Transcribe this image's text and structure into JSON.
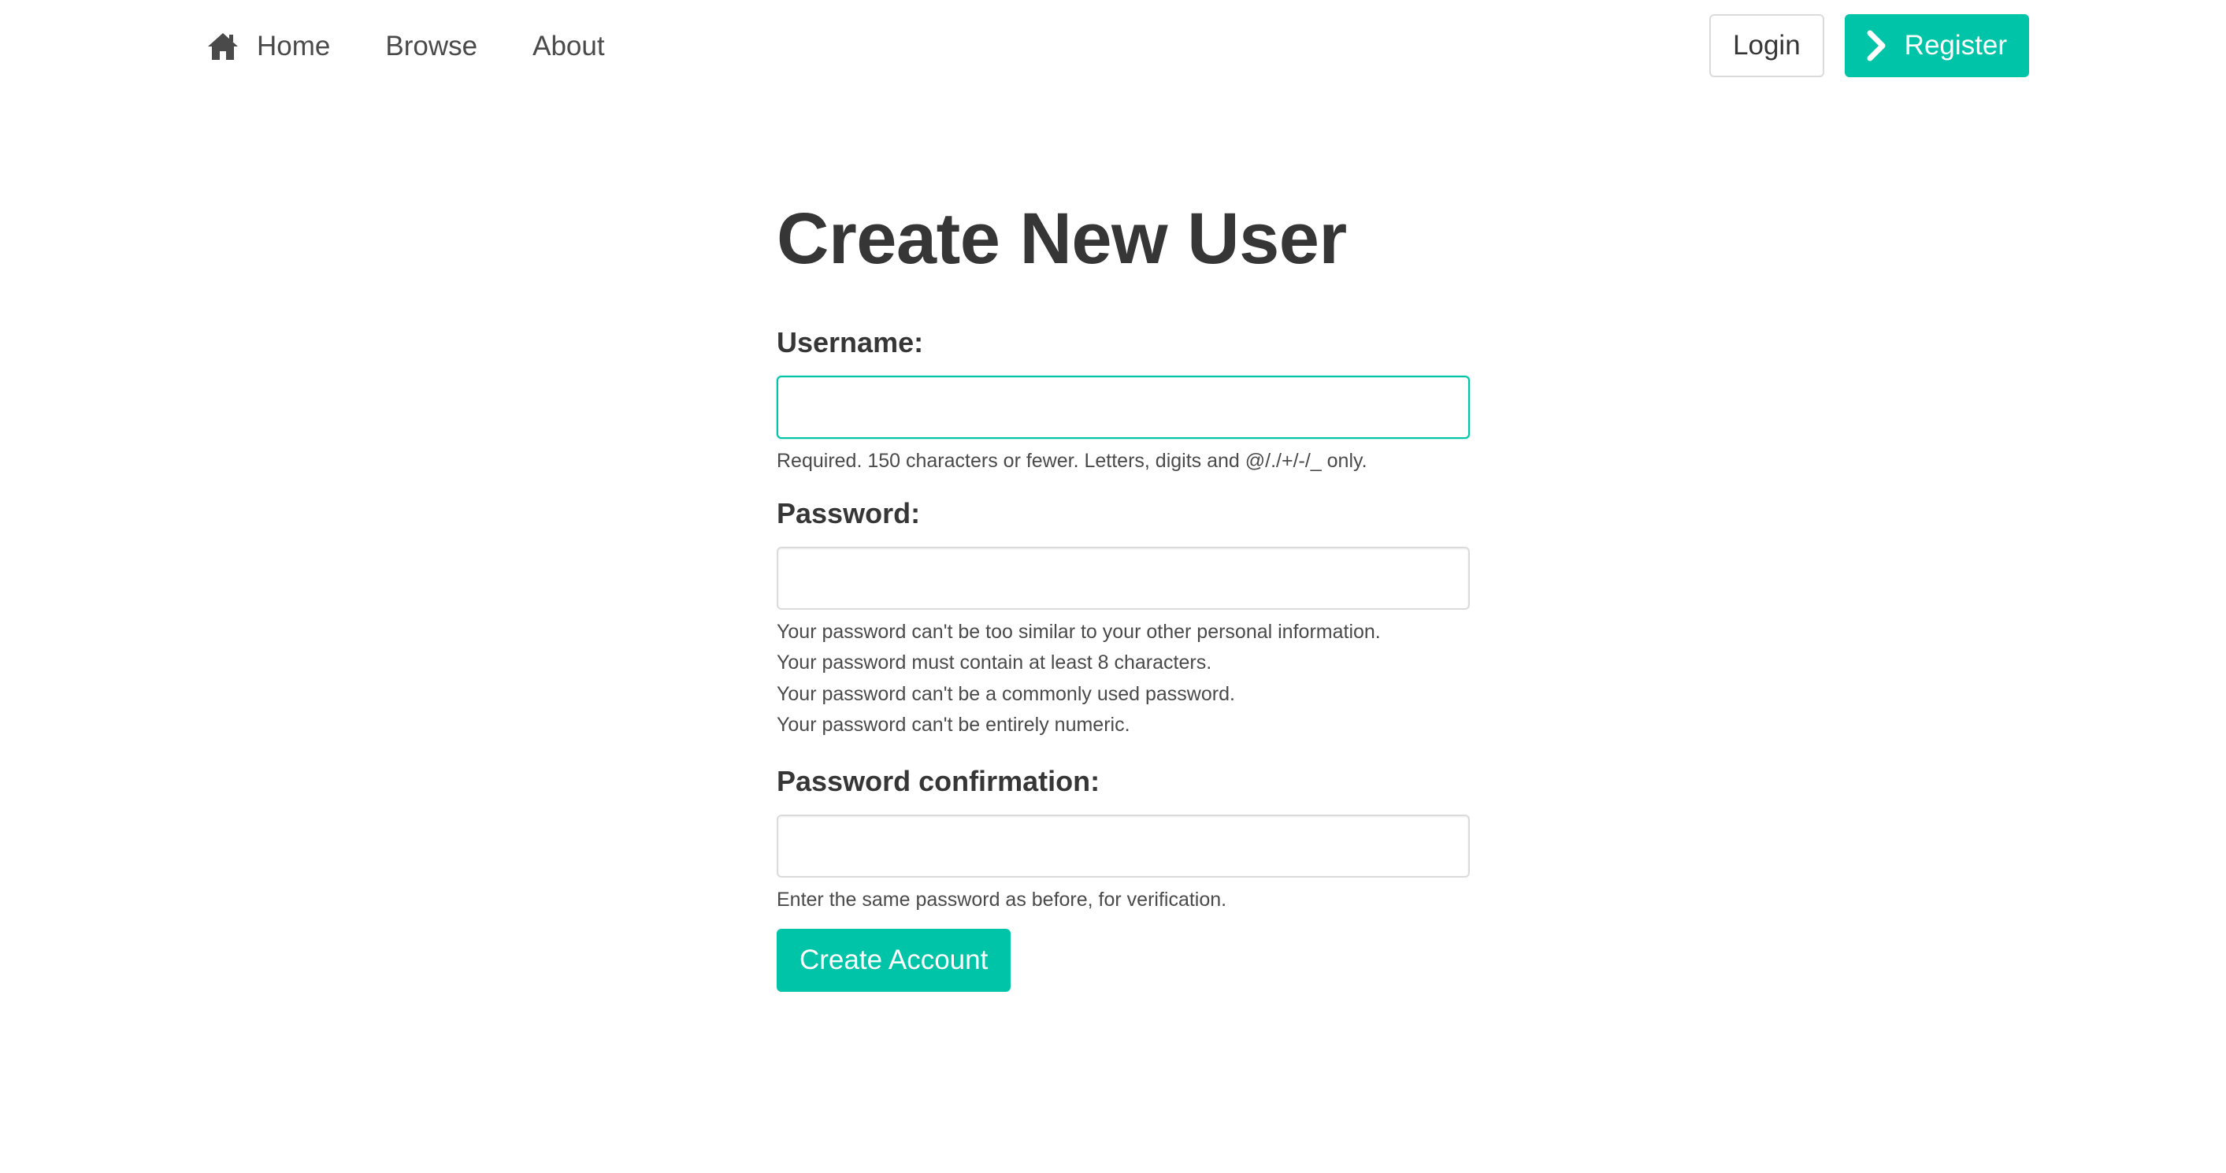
{
  "nav": {
    "home": {
      "label": "Home",
      "icon": "home-icon"
    },
    "browse": {
      "label": "Browse"
    },
    "about": {
      "label": "About"
    },
    "login": {
      "label": "Login"
    },
    "register": {
      "label": "Register",
      "icon": "chevron-right-icon"
    }
  },
  "form": {
    "title": "Create New User",
    "username": {
      "label": "Username:",
      "value": "",
      "help": "Required. 150 characters or fewer. Letters, digits and @/./+/-/_ only."
    },
    "password": {
      "label": "Password:",
      "value": "",
      "help": [
        "Your password can't be too similar to your other personal information.",
        "Your password must contain at least 8 characters.",
        "Your password can't be a commonly used password.",
        "Your password can't be entirely numeric."
      ]
    },
    "password_confirmation": {
      "label": "Password confirmation:",
      "value": "",
      "help": "Enter the same password as before, for verification."
    },
    "submit_label": "Create Account"
  },
  "colors": {
    "primary": "#00c4a7",
    "text": "#363636",
    "border": "#dbdbdb"
  }
}
